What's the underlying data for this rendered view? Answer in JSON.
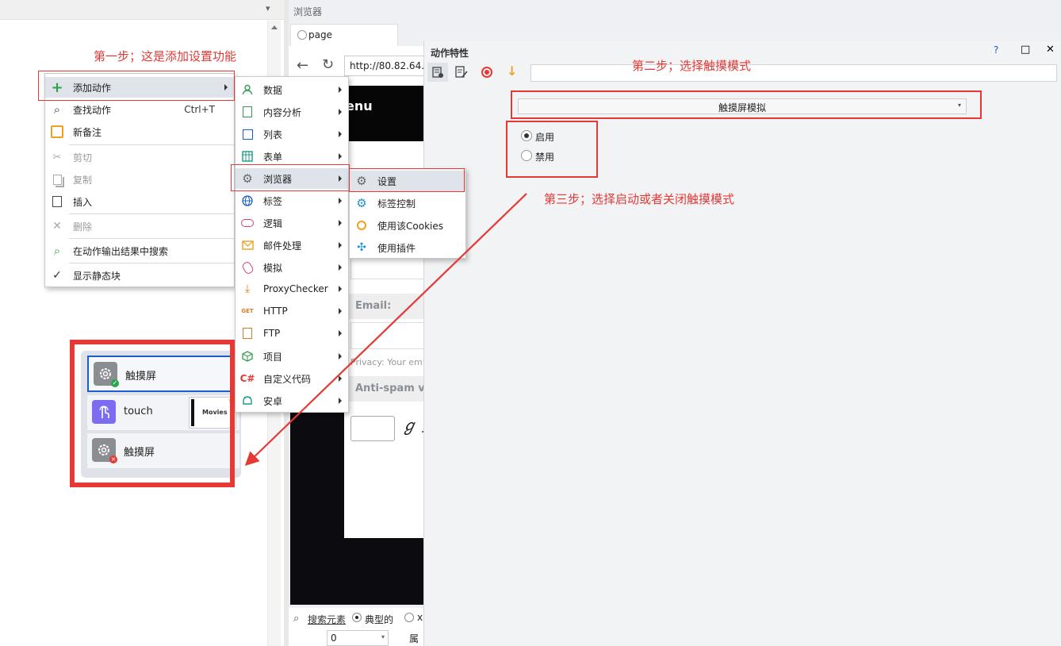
{
  "top_left_bar": {
    "arrow": "▾"
  },
  "browser_panel": {
    "title": "浏览器",
    "tab_label": "page",
    "url": "http://80.82.64.",
    "menu_heading_partial": "enu",
    "email_label": "Email:",
    "privacy_text": "Privacy: Your em",
    "antispam_text": "Anti-spam ve",
    "captcha_glyph": "ℊ∮",
    "search_elements_label": "搜索元素",
    "radio_typical_label": "典型的",
    "radio_other_partial": "x",
    "number_select_value": "0",
    "attr_label_partial": "属"
  },
  "context_menu": {
    "items": [
      {
        "label": "添加动作",
        "icon": "plus-icon",
        "submenu": true
      },
      {
        "label": "查找动作",
        "icon": "search-icon",
        "shortcut": "Ctrl+T"
      },
      {
        "label": "新备注",
        "icon": "note-icon"
      },
      {
        "label": "剪切",
        "icon": "scissors-icon",
        "disabled": true
      },
      {
        "label": "复制",
        "icon": "copy-icon",
        "disabled": true
      },
      {
        "label": "插入",
        "icon": "paste-icon"
      },
      {
        "label": "删除",
        "icon": "close-icon",
        "disabled": true
      },
      {
        "label": "在动作输出结果中搜索",
        "icon": "search-results-icon"
      },
      {
        "label": "显示静态块",
        "icon": "check-icon"
      }
    ]
  },
  "add_action_submenu": {
    "items": [
      {
        "label": "数据",
        "icon": "user-icon"
      },
      {
        "label": "内容分析",
        "icon": "document-icon"
      },
      {
        "label": "列表",
        "icon": "list-icon"
      },
      {
        "label": "表单",
        "icon": "table-icon"
      },
      {
        "label": "浏览器",
        "icon": "gear-icon"
      },
      {
        "label": "标签",
        "icon": "globe-icon"
      },
      {
        "label": "逻辑",
        "icon": "toggle-icon"
      },
      {
        "label": "邮件处理",
        "icon": "mail-icon"
      },
      {
        "label": "模拟",
        "icon": "mouse-icon"
      },
      {
        "label": "ProxyChecker",
        "icon": "download-icon"
      },
      {
        "label": "HTTP",
        "icon": "http-get-icon"
      },
      {
        "label": "FTP",
        "icon": "ftp-icon"
      },
      {
        "label": "项目",
        "icon": "cube-icon"
      },
      {
        "label": "自定义代码",
        "icon": "csharp-icon",
        "icon_text": "C#"
      },
      {
        "label": "安卓",
        "icon": "android-icon"
      }
    ]
  },
  "browser_submenu": {
    "items": [
      {
        "label": "设置",
        "icon": "gear-icon"
      },
      {
        "label": "标签控制",
        "icon": "gear-blue-icon"
      },
      {
        "label": "使用该Cookies",
        "icon": "cookie-icon"
      },
      {
        "label": "使用插件",
        "icon": "puzzle-icon"
      }
    ]
  },
  "action_blocks": [
    {
      "label": "触摸屏",
      "icon": "gear-icon",
      "status": "success"
    },
    {
      "label": "touch",
      "icon": "touch-icon",
      "thumb_label": "Movies"
    },
    {
      "label": "触摸屏",
      "icon": "gear-icon",
      "status": "error"
    }
  ],
  "properties_panel": {
    "title": "动作特性",
    "help": "?",
    "maximize": "□",
    "close": "✕",
    "toolbar_input_value": "",
    "mode_select": "触摸屏模拟",
    "radio_enable": "启用",
    "radio_disable": "禁用",
    "enable_selected": true
  },
  "annotations": {
    "step1": "第一步；这是添加设置功能",
    "step2": "第二步；选择触摸模式",
    "step3": "第三步；选择启动或者关闭触摸模式"
  },
  "colors": {
    "annotation_red": "#e53935",
    "panel_bg": "#f2f3f5",
    "accent_blue": "#1a5fc7",
    "touch_purple": "#7b6cf0"
  }
}
